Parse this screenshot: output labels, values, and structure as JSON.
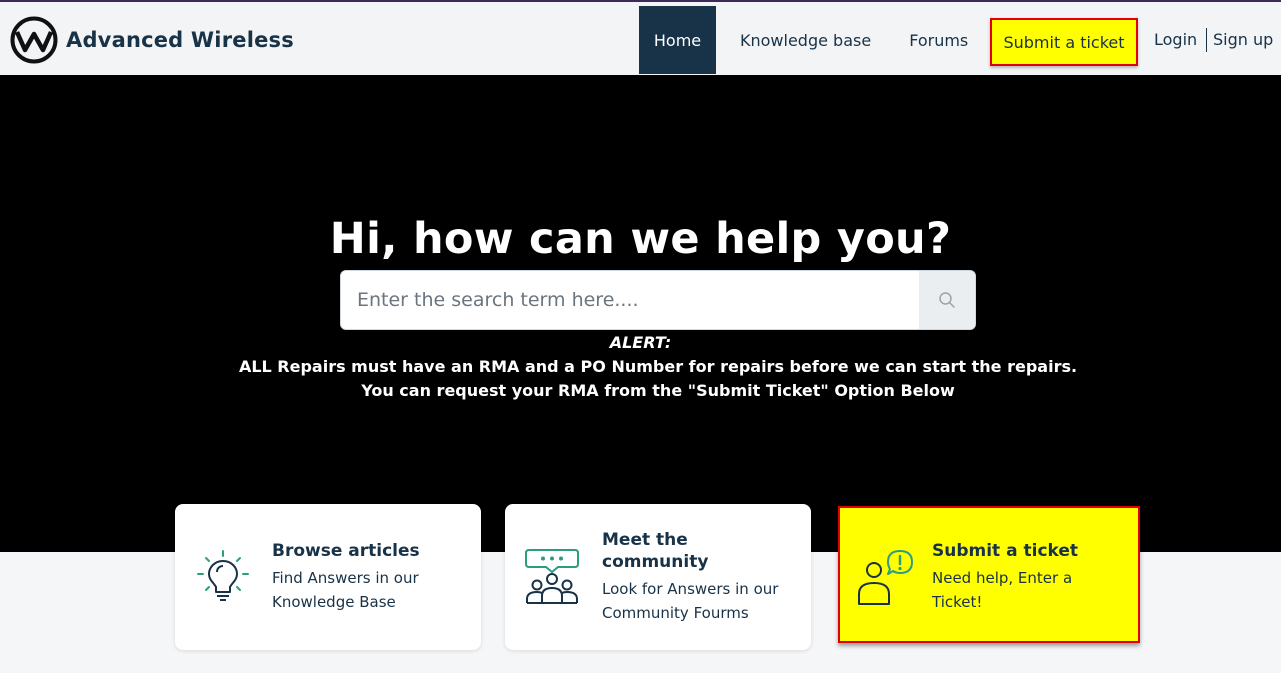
{
  "header": {
    "brand": "Advanced Wireless",
    "nav": {
      "home": "Home",
      "knowledge_base": "Knowledge base",
      "forums": "Forums",
      "submit_ticket": "Submit a ticket",
      "login": "Login",
      "signup": "Sign up"
    }
  },
  "hero": {
    "title": "Hi, how can we help you?",
    "search": {
      "placeholder": "Enter the search term here...."
    },
    "alert": {
      "heading": "ALERT:",
      "line1": "ALL Repairs must have an RMA and a PO Number for repairs before we can start the repairs.",
      "line2": "You can request your RMA from the \"Submit Ticket\" Option Below"
    }
  },
  "cards": [
    {
      "title": "Browse articles",
      "desc_line1": "Find Answers in our",
      "desc_line2": "Knowledge Base",
      "icon": "lightbulb-icon"
    },
    {
      "title_line1": "Meet the",
      "title_line2": "community",
      "desc_line1": "Look for Answers in our",
      "desc_line2": "Community Fourms",
      "icon": "community-icon"
    },
    {
      "title": "Submit a ticket",
      "desc_line1": "Need help, Enter a",
      "desc_line2": "Ticket!",
      "icon": "user-alert-icon"
    }
  ],
  "colors": {
    "primary": "#183247",
    "highlight": "#ffff00",
    "highlight_border": "#e00000",
    "icon_green": "#2c9d7f",
    "hero_bg": "#000000"
  }
}
